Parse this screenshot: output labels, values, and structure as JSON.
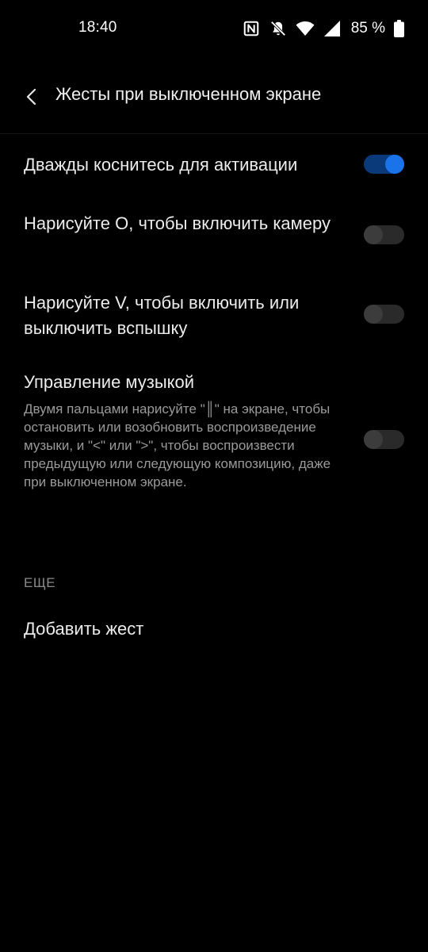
{
  "status_bar": {
    "time": "18:40",
    "battery": "85 %",
    "icons": [
      "nfc-icon",
      "bell-off-icon",
      "wifi-icon",
      "signal-icon",
      "battery-icon"
    ]
  },
  "app_bar": {
    "title": "Жесты при выключенном экране"
  },
  "settings": [
    {
      "title": "Дважды коснитесь для активации",
      "enabled": true
    },
    {
      "title": "Нарисуйте O, чтобы включить камеру",
      "enabled": false
    },
    {
      "title": "Нарисуйте V, чтобы включить или выключить вспышку",
      "enabled": false
    },
    {
      "title": "Управление музыкой",
      "summary": "Двумя пальцами нарисуйте \"║\" на экране, чтобы остановить или возобновить воспроизведение музыки, и \"<\" или \">\", чтобы воспроизвести предыдущую или следующую композицию, даже при выключенном экране.",
      "enabled": false
    }
  ],
  "more_section": {
    "header": "ЕЩЕ",
    "add_gesture": "Добавить жест"
  },
  "colors": {
    "background": "#000000",
    "accent": "#1a73e8",
    "accent_track": "#0a3a7a",
    "text_primary": "#ececec",
    "text_secondary": "#9a9a9a"
  }
}
